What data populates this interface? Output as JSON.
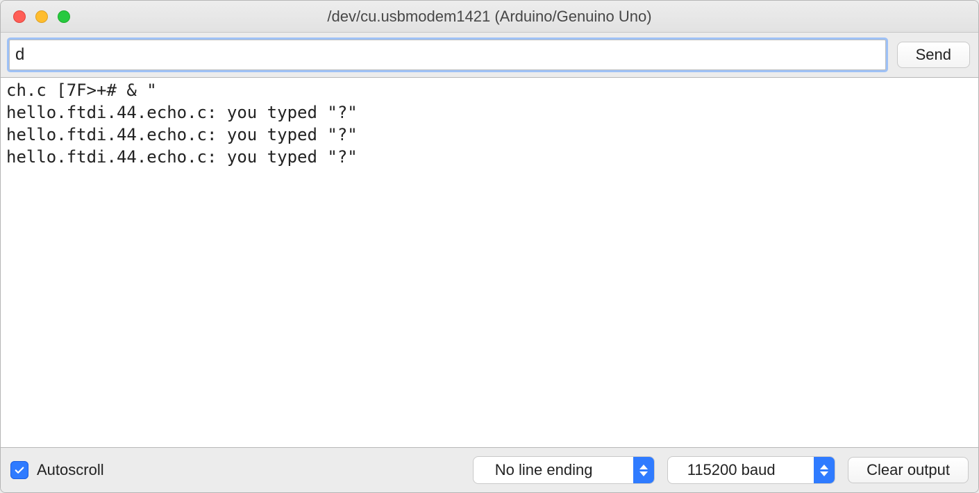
{
  "window": {
    "title": "/dev/cu.usbmodem1421 (Arduino/Genuino Uno)"
  },
  "input": {
    "value": "d",
    "send_label": "Send"
  },
  "output": {
    "text": "ch.c [7F>+# & \"\nhello.ftdi.44.echo.c: you typed \"?\"\nhello.ftdi.44.echo.c: you typed \"?\"\nhello.ftdi.44.echo.c: you typed \"?\""
  },
  "footer": {
    "autoscroll_label": "Autoscroll",
    "autoscroll_checked": true,
    "line_ending_selected": "No line ending",
    "baud_selected": "115200 baud",
    "clear_label": "Clear output"
  }
}
